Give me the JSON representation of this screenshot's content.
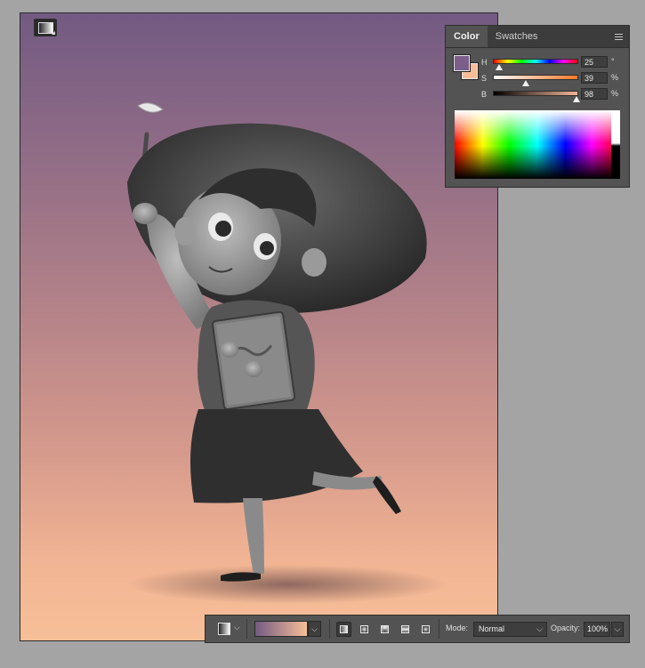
{
  "colors": {
    "canvas_top": "#735a82",
    "canvas_bottom": "#f7bf98",
    "foreground": "#7b5f8a",
    "background": "#f7bd98",
    "panel_bg": "#535353",
    "app_bg": "#a4a4a4"
  },
  "canvas": {
    "tool_icon": "gradient-tool-icon",
    "illustration": "girl-with-book-and-wand-drawing"
  },
  "color_panel": {
    "tabs": [
      {
        "label": "Color",
        "active": true
      },
      {
        "label": "Swatches",
        "active": false
      }
    ],
    "menu_icon": "panel-menu-icon",
    "sliders": [
      {
        "label": "H",
        "value": "25",
        "unit": "°",
        "fraction": 0.07
      },
      {
        "label": "S",
        "value": "39",
        "unit": "%",
        "fraction": 0.39
      },
      {
        "label": "B",
        "value": "98",
        "unit": "%",
        "fraction": 0.98
      }
    ]
  },
  "options_bar": {
    "preset_icon": "gradient-preset-icon",
    "gradient_types": [
      {
        "name": "linear",
        "active": true
      },
      {
        "name": "radial",
        "active": false
      },
      {
        "name": "angle",
        "active": false
      },
      {
        "name": "reflected",
        "active": false
      },
      {
        "name": "diamond",
        "active": false
      }
    ],
    "mode_label": "Mode:",
    "mode_value": "Normal",
    "opacity_label": "Opacity:",
    "opacity_value": "100%"
  }
}
